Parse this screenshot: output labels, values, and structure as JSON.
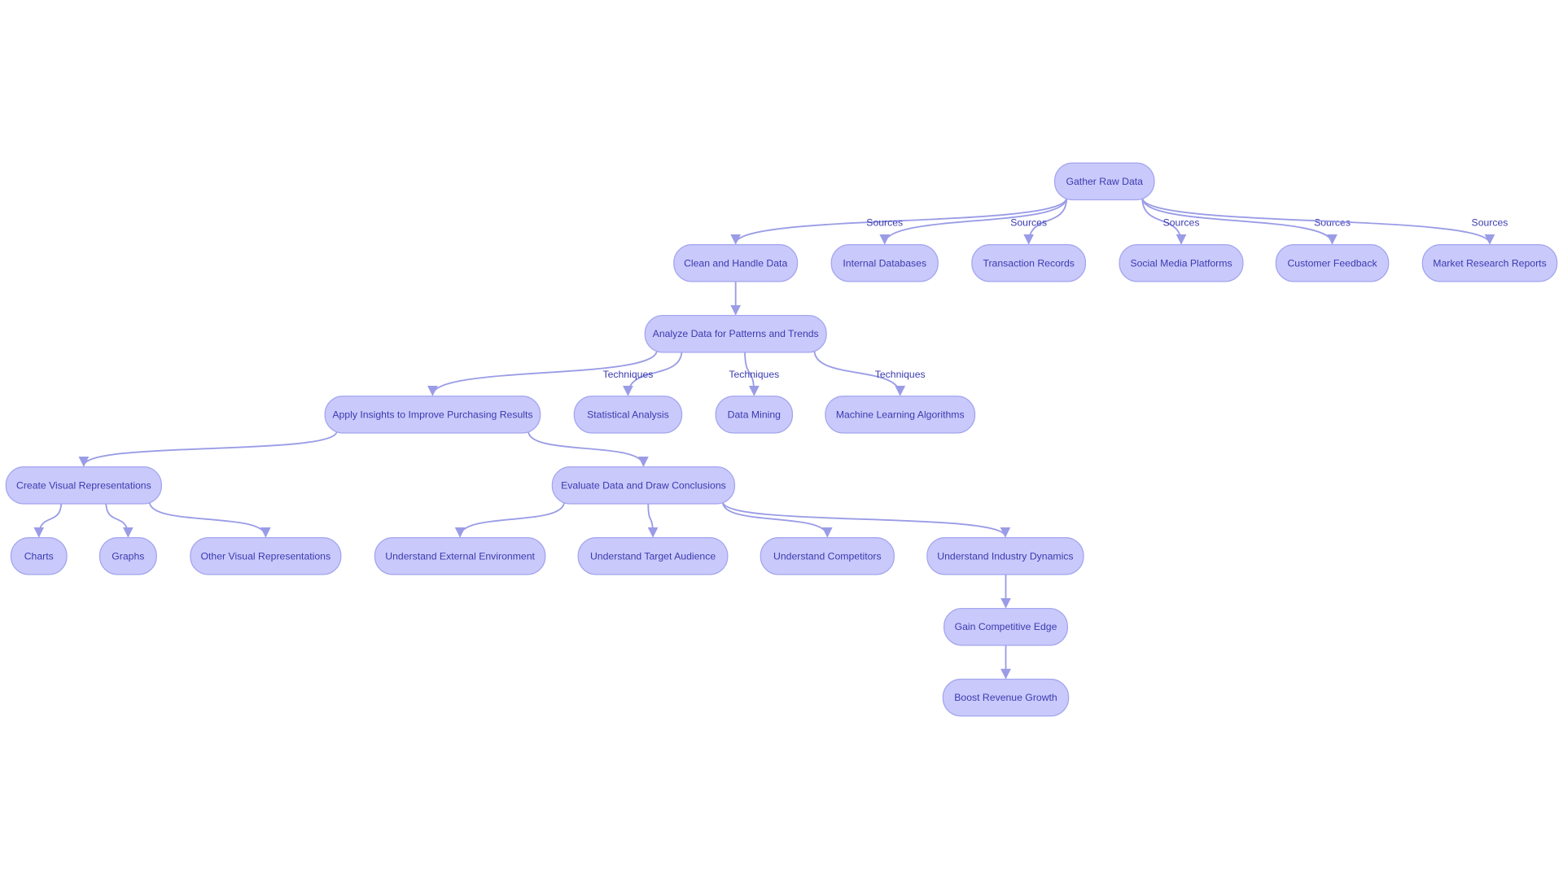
{
  "colors": {
    "node_fill": "#c9c9fb",
    "node_stroke": "#a3a5ee",
    "edge": "#9a9ce6",
    "text": "#3b3bb0"
  },
  "nodes": [
    {
      "id": "gather",
      "label": "Gather Raw Data"
    },
    {
      "id": "clean",
      "label": "Clean and Handle Data"
    },
    {
      "id": "internal",
      "label": "Internal Databases"
    },
    {
      "id": "transaction",
      "label": "Transaction Records"
    },
    {
      "id": "social",
      "label": "Social Media Platforms"
    },
    {
      "id": "feedback",
      "label": "Customer Feedback"
    },
    {
      "id": "market",
      "label": "Market Research Reports"
    },
    {
      "id": "analyze",
      "label": "Analyze Data for Patterns and Trends"
    },
    {
      "id": "apply",
      "label": "Apply Insights to Improve Purchasing Results"
    },
    {
      "id": "stat",
      "label": "Statistical Analysis"
    },
    {
      "id": "mining",
      "label": "Data Mining"
    },
    {
      "id": "ml",
      "label": "Machine Learning Algorithms"
    },
    {
      "id": "visual",
      "label": "Create Visual Representations"
    },
    {
      "id": "evaluate",
      "label": "Evaluate Data and Draw Conclusions"
    },
    {
      "id": "charts",
      "label": "Charts"
    },
    {
      "id": "graphs",
      "label": "Graphs"
    },
    {
      "id": "othervis",
      "label": "Other Visual Representations"
    },
    {
      "id": "external",
      "label": "Understand External Environment"
    },
    {
      "id": "audience",
      "label": "Understand Target Audience"
    },
    {
      "id": "competitors",
      "label": "Understand Competitors"
    },
    {
      "id": "industry",
      "label": "Understand Industry Dynamics"
    },
    {
      "id": "edge",
      "label": "Gain Competitive Edge"
    },
    {
      "id": "revenue",
      "label": "Boost Revenue Growth"
    }
  ],
  "edges": [
    {
      "from": "gather",
      "to": "clean",
      "label": ""
    },
    {
      "from": "gather",
      "to": "internal",
      "label": "Sources"
    },
    {
      "from": "gather",
      "to": "transaction",
      "label": "Sources"
    },
    {
      "from": "gather",
      "to": "social",
      "label": "Sources"
    },
    {
      "from": "gather",
      "to": "feedback",
      "label": "Sources"
    },
    {
      "from": "gather",
      "to": "market",
      "label": "Sources"
    },
    {
      "from": "clean",
      "to": "analyze",
      "label": ""
    },
    {
      "from": "analyze",
      "to": "apply",
      "label": ""
    },
    {
      "from": "analyze",
      "to": "stat",
      "label": "Techniques"
    },
    {
      "from": "analyze",
      "to": "mining",
      "label": "Techniques"
    },
    {
      "from": "analyze",
      "to": "ml",
      "label": "Techniques"
    },
    {
      "from": "apply",
      "to": "visual",
      "label": ""
    },
    {
      "from": "apply",
      "to": "evaluate",
      "label": ""
    },
    {
      "from": "visual",
      "to": "charts",
      "label": ""
    },
    {
      "from": "visual",
      "to": "graphs",
      "label": ""
    },
    {
      "from": "visual",
      "to": "othervis",
      "label": ""
    },
    {
      "from": "evaluate",
      "to": "external",
      "label": ""
    },
    {
      "from": "evaluate",
      "to": "audience",
      "label": ""
    },
    {
      "from": "evaluate",
      "to": "competitors",
      "label": ""
    },
    {
      "from": "evaluate",
      "to": "industry",
      "label": ""
    },
    {
      "from": "industry",
      "to": "edge",
      "label": ""
    },
    {
      "from": "edge",
      "to": "revenue",
      "label": ""
    }
  ]
}
